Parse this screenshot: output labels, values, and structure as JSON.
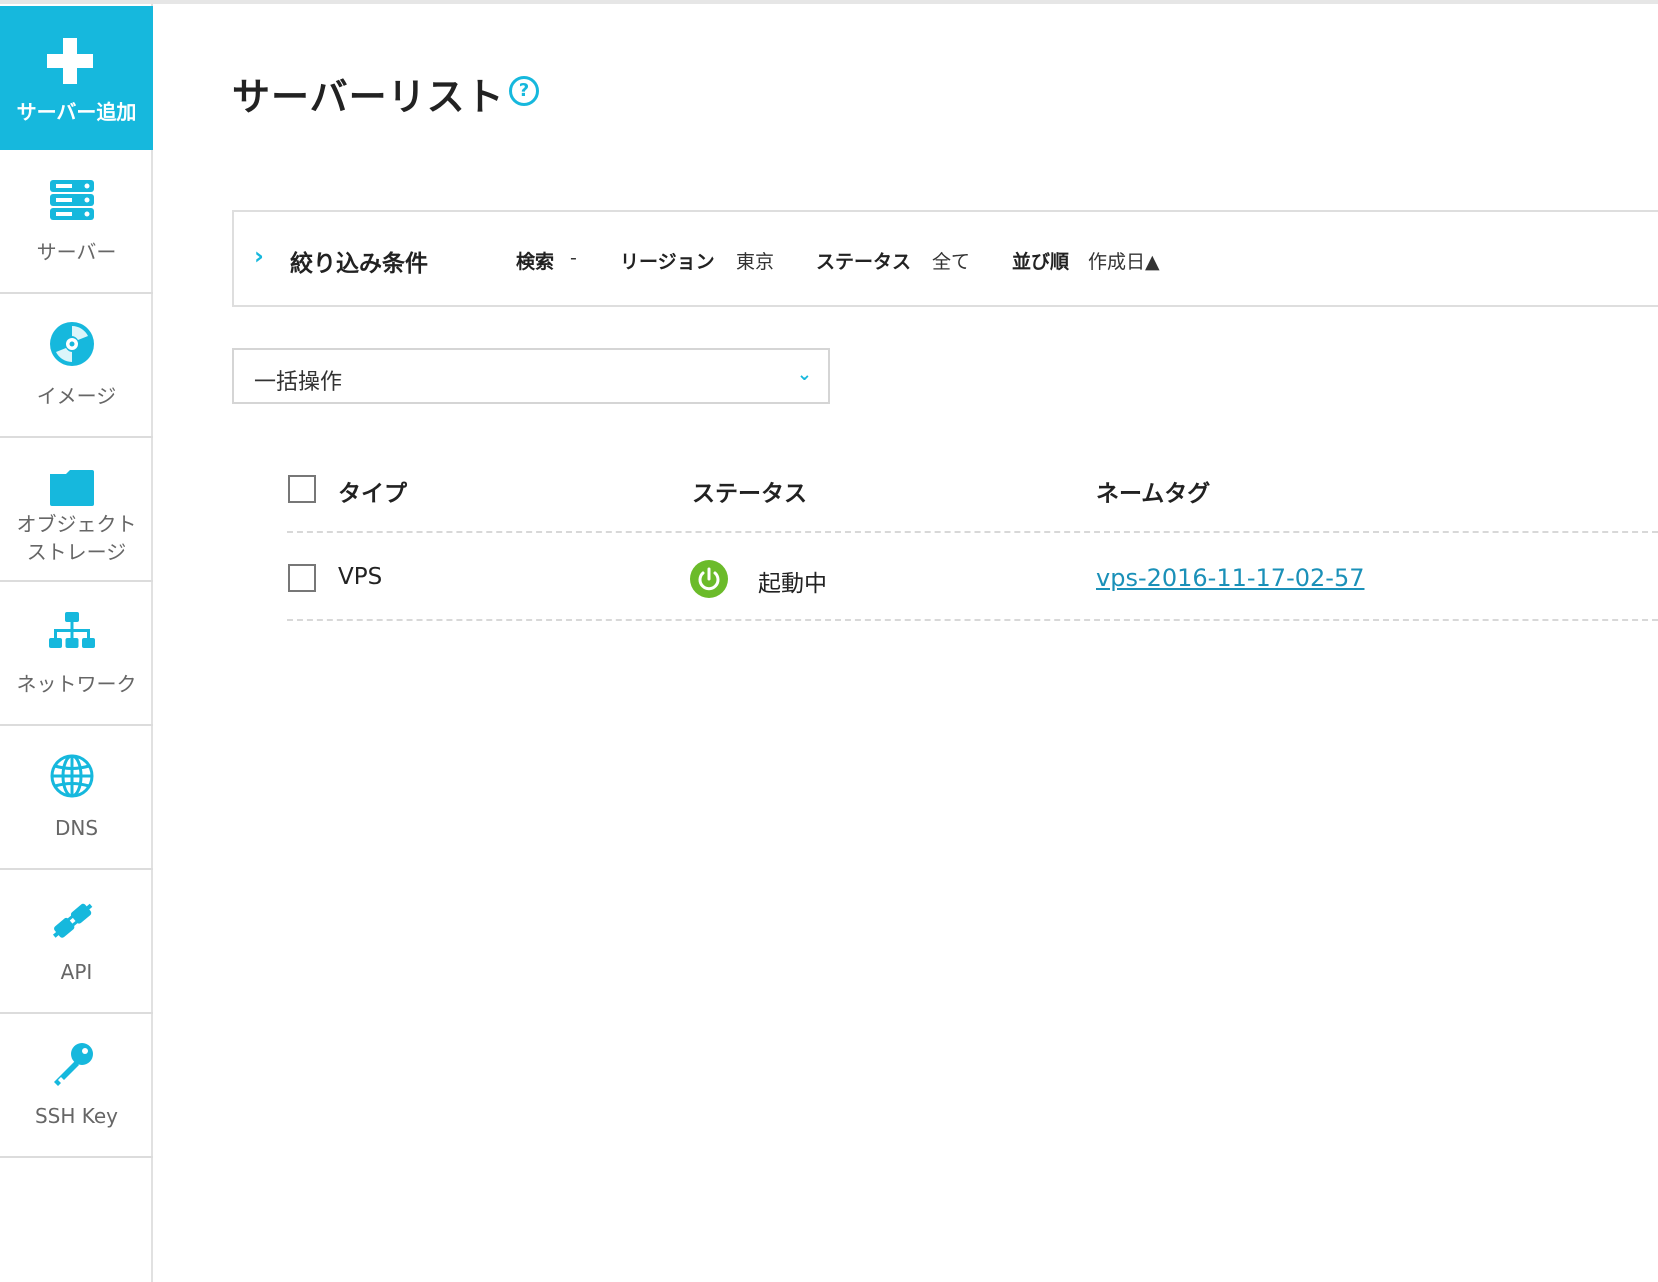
{
  "sidebar": {
    "add_button": {
      "label": "サーバー追加",
      "icon": "plus-icon"
    },
    "items": [
      {
        "label": "サーバー",
        "icon": "server-icon"
      },
      {
        "label": "イメージ",
        "icon": "disc-icon"
      },
      {
        "label": "オブジェクト\nストレージ",
        "icon": "folder-icon"
      },
      {
        "label": "ネットワーク",
        "icon": "network-icon"
      },
      {
        "label": "DNS",
        "icon": "globe-icon"
      },
      {
        "label": "API",
        "icon": "plug-icon"
      },
      {
        "label": "SSH Key",
        "icon": "key-icon"
      }
    ]
  },
  "page": {
    "title": "サーバーリスト",
    "help_icon": "?"
  },
  "filter": {
    "toggle_icon": "›",
    "title": "絞り込み条件",
    "search_label": "検索",
    "search_value": "-",
    "region_label": "リージョン",
    "region_value": "東京",
    "status_label": "ステータス",
    "status_value": "全て",
    "sort_label": "並び順",
    "sort_value": "作成日▲"
  },
  "bulk_action": {
    "label": "一括操作",
    "caret": "⌄"
  },
  "table": {
    "headers": {
      "type": "タイプ",
      "status": "ステータス",
      "name_tag": "ネームタグ"
    },
    "rows": [
      {
        "type": "VPS",
        "status": "起動中",
        "name_tag": "vps-2016-11-17-02-57"
      }
    ]
  },
  "colors": {
    "accent": "#16b8dd",
    "running": "#6bbb2a",
    "link": "#1a90b8"
  }
}
